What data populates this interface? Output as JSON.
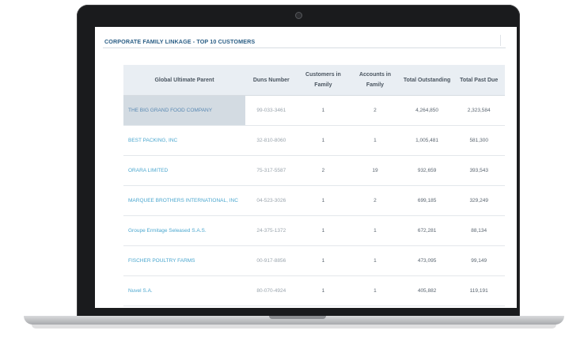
{
  "report": {
    "title": "CORPORATE FAMILY LINKAGE - TOP 10 CUSTOMERS"
  },
  "table": {
    "columns": [
      "Global Ultimate Parent",
      "Duns Number",
      "Customers in Family",
      "Accounts in Family",
      "Total Outstanding",
      "Total Past Due"
    ],
    "rows": [
      {
        "parent": "THE BIG GRAND FOOD COMPANY",
        "duns": "99-033-3461",
        "customers": "1",
        "accounts": "2",
        "outstanding": "4,264,850",
        "past_due": "2,323,584"
      },
      {
        "parent": "BEST PACKING, INC",
        "duns": "32-810-8060",
        "customers": "1",
        "accounts": "1",
        "outstanding": "1,005,481",
        "past_due": "581,300"
      },
      {
        "parent": "ORARA LIMITED",
        "duns": "75-317-5587",
        "customers": "2",
        "accounts": "19",
        "outstanding": "932,659",
        "past_due": "393,543"
      },
      {
        "parent": "MARQUEE BROTHERS INTERNATIONAL, INC",
        "duns": "04-523-3026",
        "customers": "1",
        "accounts": "2",
        "outstanding": "699,185",
        "past_due": "329,249"
      },
      {
        "parent": "Groupe Ermitage Seleased S.A.S.",
        "duns": "24-375-1372",
        "customers": "1",
        "accounts": "1",
        "outstanding": "672,281",
        "past_due": "88,134"
      },
      {
        "parent": "FISCHER POULTRY FARMS",
        "duns": "00-917-8856",
        "customers": "1",
        "accounts": "1",
        "outstanding": "473,095",
        "past_due": "99,149"
      },
      {
        "parent": "Nuvel S.A.",
        "duns": "80-070-4924",
        "customers": "1",
        "accounts": "1",
        "outstanding": "405,882",
        "past_due": "119,191"
      }
    ]
  }
}
